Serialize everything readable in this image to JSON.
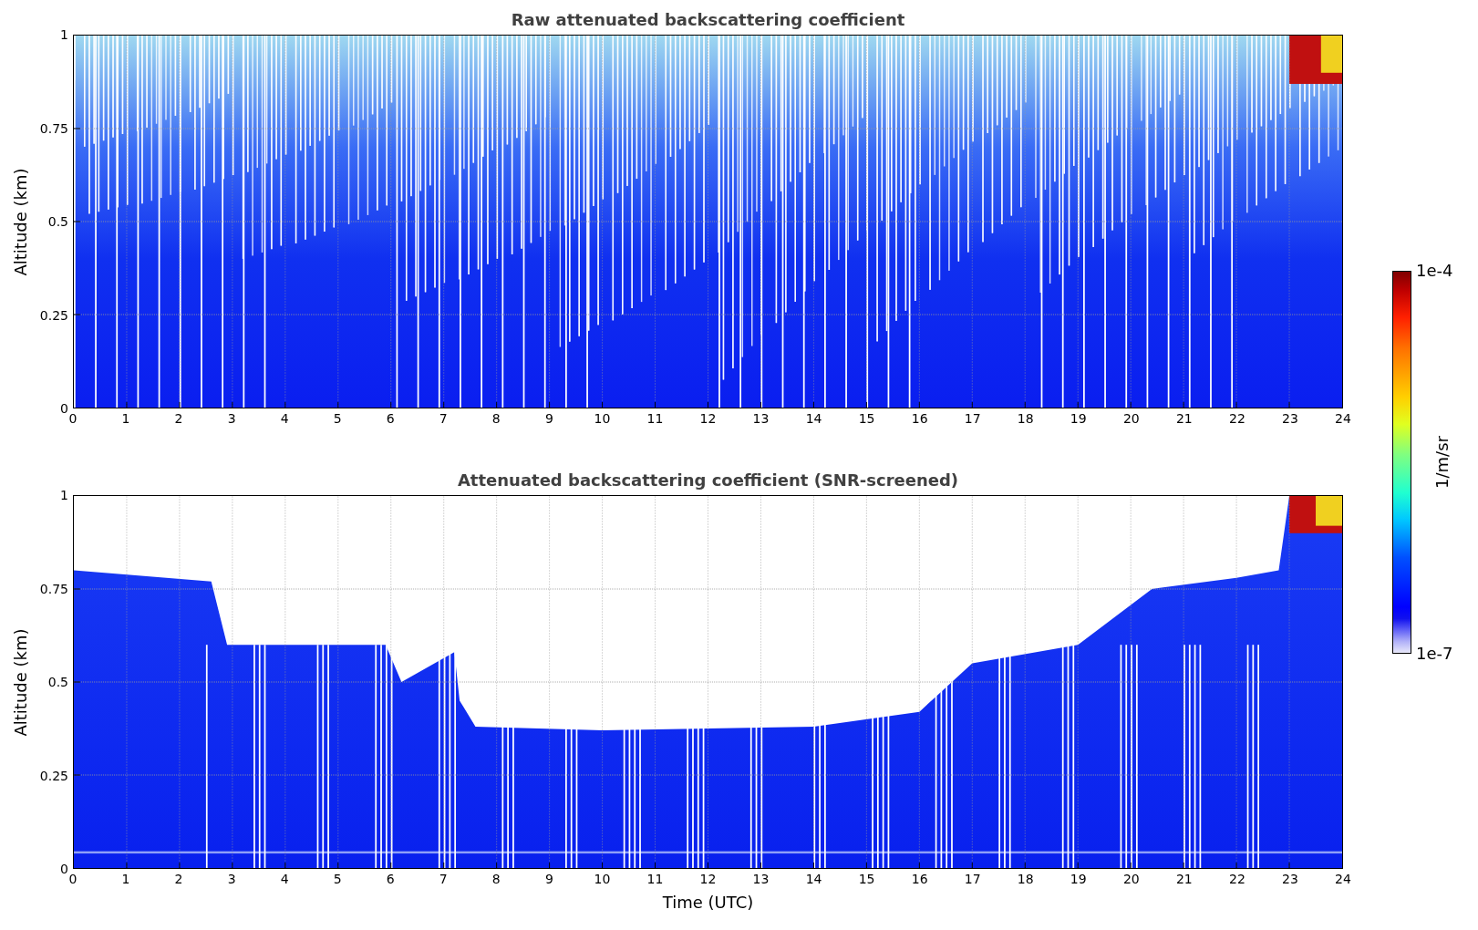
{
  "panels": [
    {
      "kind": "raw",
      "title": "Raw attenuated backscattering coefficient",
      "ylabel": "Altitude (km)",
      "yticks": [
        "1",
        "0.75",
        "0.5",
        "0.25",
        "0"
      ],
      "xticks": [
        "0",
        "1",
        "2",
        "3",
        "4",
        "5",
        "6",
        "7",
        "8",
        "9",
        "10",
        "11",
        "12",
        "13",
        "14",
        "15",
        "16",
        "17",
        "18",
        "19",
        "20",
        "21",
        "22",
        "23",
        "24"
      ]
    },
    {
      "kind": "screened",
      "title": "Attenuated backscattering coefficient (SNR-screened)",
      "ylabel": "Altitude (km)",
      "yticks": [
        "1",
        "0.75",
        "0.5",
        "0.25",
        "0"
      ],
      "xticks": [
        "0",
        "1",
        "2",
        "3",
        "4",
        "5",
        "6",
        "7",
        "8",
        "9",
        "10",
        "11",
        "12",
        "13",
        "14",
        "15",
        "16",
        "17",
        "18",
        "19",
        "20",
        "21",
        "22",
        "23",
        "24"
      ],
      "xlabel": "Time (UTC)"
    }
  ],
  "colorbar": {
    "max_label": "1e-4",
    "min_label": "1e-7",
    "unit": "1/m/sr"
  }
}
